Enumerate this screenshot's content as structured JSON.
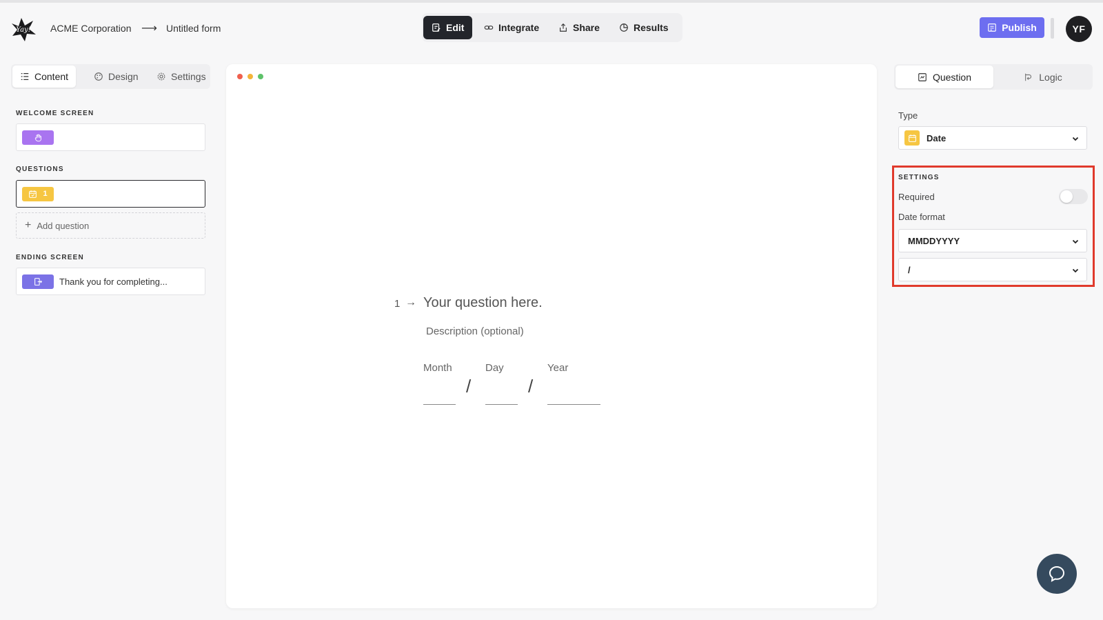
{
  "header": {
    "org_name": "ACME Corporation",
    "separator": "⟶",
    "form_name": "Untitled form",
    "logo_icon": "yay-forms-logo",
    "modes": [
      {
        "label": "Edit",
        "icon": "edit-icon",
        "active": true
      },
      {
        "label": "Integrate",
        "icon": "link-icon",
        "active": false
      },
      {
        "label": "Share",
        "icon": "share-icon",
        "active": false
      },
      {
        "label": "Results",
        "icon": "chart-icon",
        "active": false
      }
    ],
    "publish_label": "Publish",
    "avatar_initials": "YF"
  },
  "left_panel": {
    "tabs": [
      {
        "label": "Content",
        "active": true
      },
      {
        "label": "Design",
        "active": false
      },
      {
        "label": "Settings",
        "active": false
      }
    ],
    "welcome_label": "WELCOME SCREEN",
    "questions_label": "QUESTIONS",
    "question_number": "1",
    "add_question_label": "Add question",
    "ending_label": "ENDING SCREEN",
    "ending_text": "Thank you for completing..."
  },
  "preview": {
    "question_number": "1",
    "arrow": "→",
    "question_title": "Your question here.",
    "description": "Description (optional)",
    "fields": [
      "Month",
      "Day",
      "Year"
    ],
    "separator": "/"
  },
  "right_panel": {
    "tabs": [
      {
        "label": "Question",
        "active": true
      },
      {
        "label": "Logic",
        "active": false
      }
    ],
    "type_label": "Type",
    "type_value": "Date",
    "settings_label": "SETTINGS",
    "required_label": "Required",
    "required_on": false,
    "date_format_label": "Date format",
    "date_format_value": "MMDDYYYY",
    "separator_value": "/"
  },
  "colors": {
    "accent": "#6d6ef0",
    "date_badge": "#f6c642",
    "welcome_badge": "#a974f0",
    "ending_badge": "#7b72e6",
    "highlight": "#e03a2c"
  }
}
